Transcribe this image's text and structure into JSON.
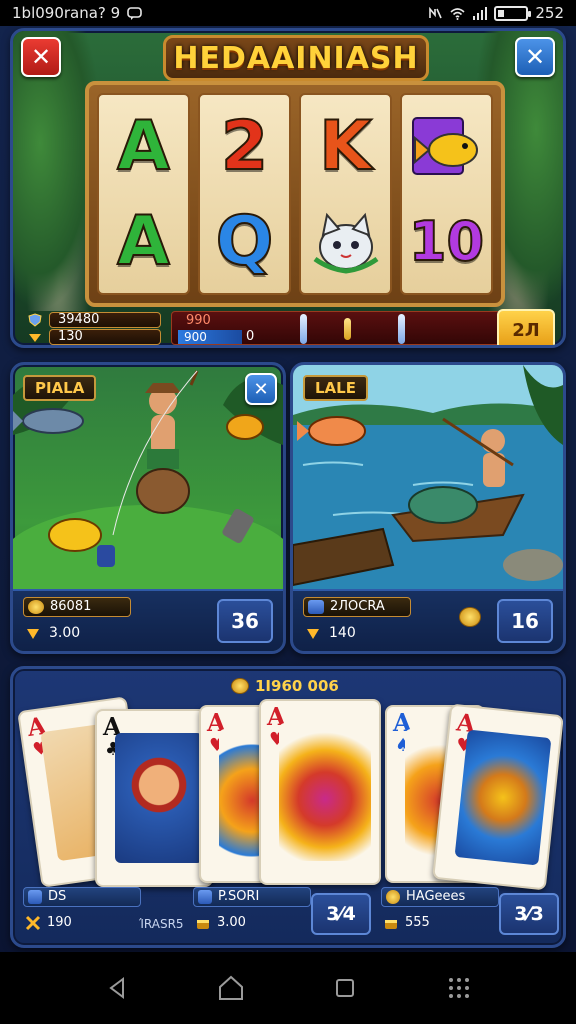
{
  "status_bar": {
    "left_text": "1bl090rana? 9",
    "time": "252"
  },
  "slot": {
    "title": "HEDAAINIASH",
    "reels": [
      [
        "A",
        "A"
      ],
      [
        "2",
        "Q"
      ],
      [
        "K",
        "cat"
      ],
      [
        "fish",
        "10"
      ]
    ],
    "stat_1": "39480",
    "stat_2": "130",
    "mid_top": "990",
    "mid_bottom_fill": "900",
    "mid_bottom_value": "0",
    "spin_label": "2Л"
  },
  "games": [
    {
      "tag": "PIALA",
      "stat_1": "86081",
      "stat_2": "3.00",
      "count": "36"
    },
    {
      "tag": "LALE",
      "stat_1": "2ЛOCRA",
      "stat_2": "140",
      "count": "16"
    }
  ],
  "cards": {
    "header": "1I960 006",
    "hands": [
      {
        "rank": "A",
        "suit": "♥"
      },
      {
        "rank": "A",
        "suit": "♣"
      },
      {
        "rank": "A",
        "suit": "♥"
      },
      {
        "rank": "A",
        "suit": "♥"
      },
      {
        "rank": "A",
        "suit": "♠"
      },
      {
        "rank": "A",
        "suit": "♥"
      }
    ],
    "footer": [
      {
        "label": "DS",
        "value": "190",
        "extra": "ΊRASR5",
        "count": ""
      },
      {
        "label": "P.SORI",
        "value": "3.00",
        "extra": "",
        "count": "3⁄4"
      },
      {
        "label": "HAGeees",
        "value": "555",
        "extra": "",
        "count": "3⁄3"
      }
    ]
  },
  "colors": {
    "accent_gold": "#ffd24a",
    "panel_blue": "#1c3470",
    "close_red": "#d42a22",
    "close_blue": "#2f78d0"
  }
}
